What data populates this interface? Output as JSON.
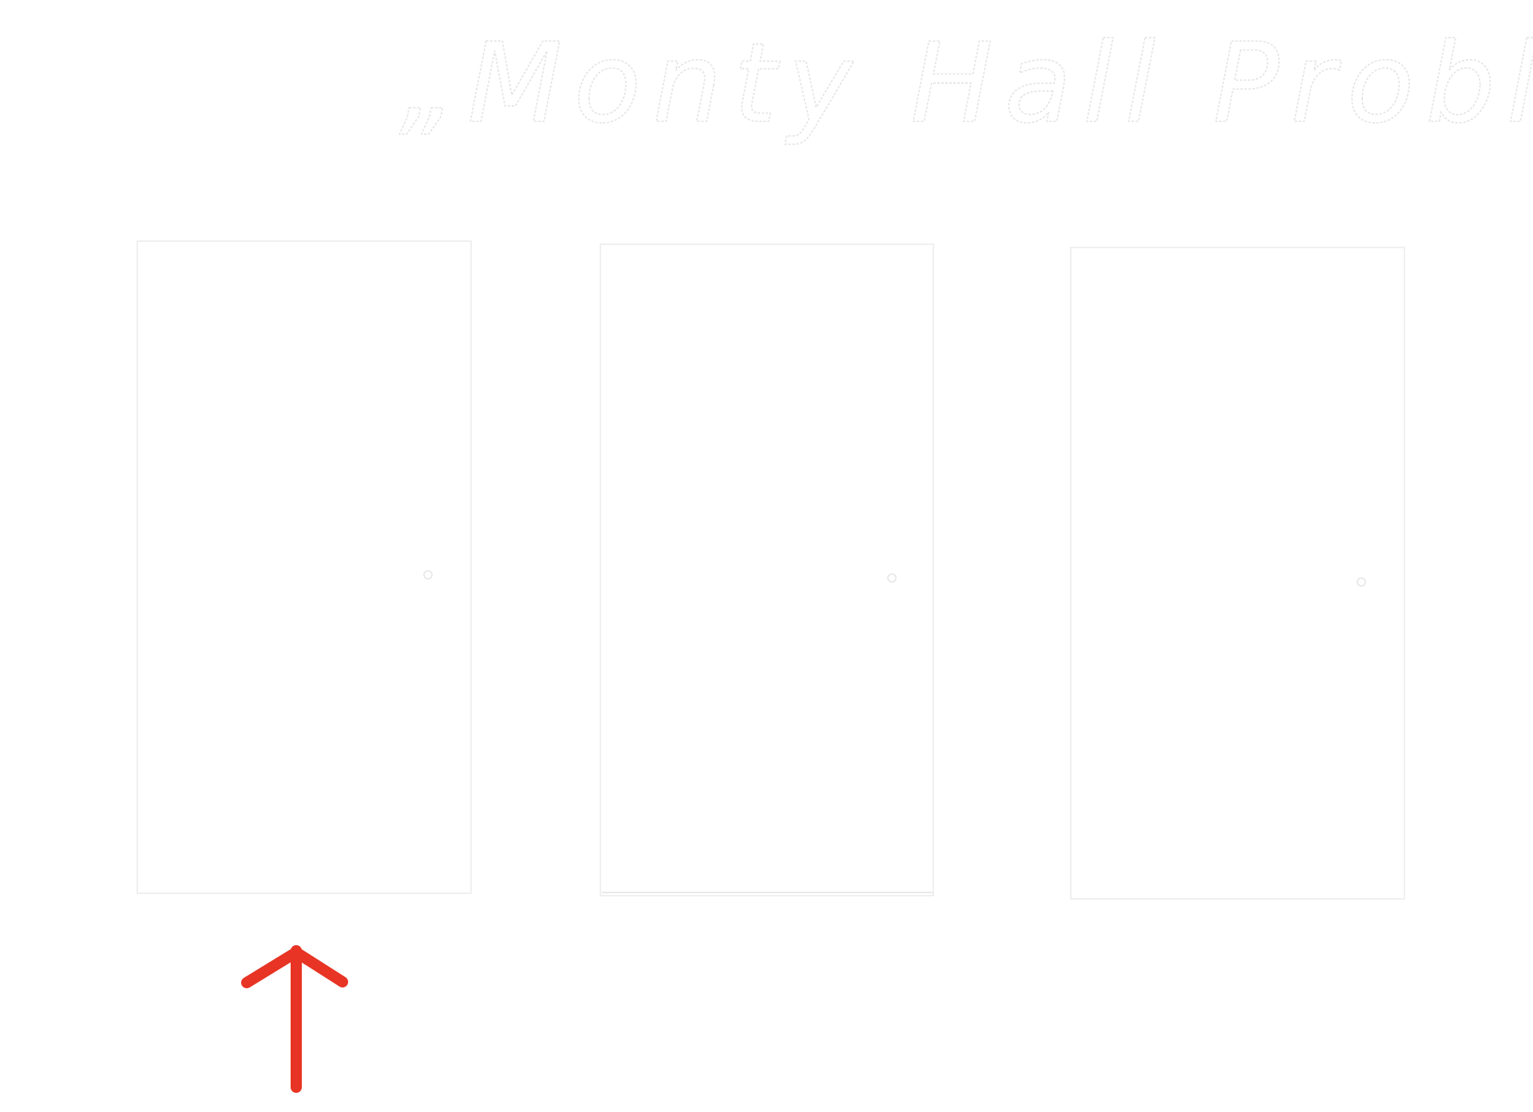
{
  "title": "„Monty Hall Problem“",
  "doors": [
    {
      "label": "door-1",
      "selected": true
    },
    {
      "label": "door-2",
      "selected": false
    },
    {
      "label": "door-3",
      "selected": false
    }
  ],
  "pointer": {
    "icon": "arrow-up-icon",
    "color": "#e73424",
    "points_to": "door-1"
  },
  "colors": {
    "background": "#ffffff",
    "door_outline": "#ececec",
    "arrow": "#e73424"
  }
}
